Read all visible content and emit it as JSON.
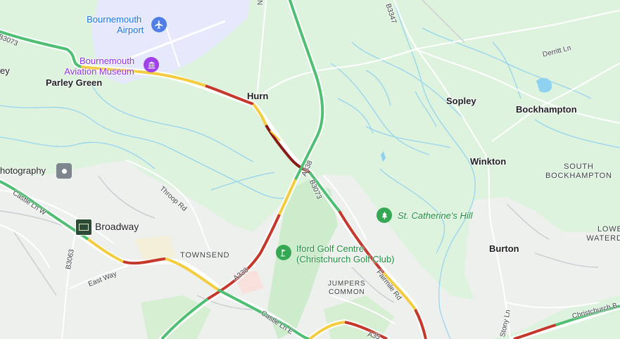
{
  "map": {
    "colors": {
      "rural": "#def3de",
      "urban": "#eef0ee",
      "airport": "#e6e9fb",
      "water": "#8fd1f0",
      "traffic_free": "#4fbf73",
      "traffic_slow": "#f3cd3f",
      "traffic_heavy": "#c5392c",
      "traffic_severe": "#8a1a15"
    },
    "places": {
      "bournemouth_airport": [
        "Bournemouth",
        "Airport"
      ],
      "aviation_museum": [
        "Bournemouth",
        "Aviation Museum"
      ],
      "parley_green": "Parley Green",
      "hurn": "Hurn",
      "sopley": "Sopley",
      "bockhampton": "Bockhampton",
      "winkton": "Winkton",
      "south_bockhampton": [
        "SOUTH",
        "BOCKHAMPTON"
      ],
      "burton": "Burton",
      "lower_waterditch": [
        "LOWE",
        "WATERD"
      ],
      "broadway": "Broadway",
      "townsend": "TOWNSEND",
      "jumpers_common": [
        "JUMPERS",
        "COMMON"
      ],
      "st_catherines_hill": "St. Catherine's Hill",
      "iford_golf": [
        "Iford Golf Centre",
        "(Christchurch Golf Club)"
      ],
      "photography": "hotography",
      "ey": "ey"
    },
    "roads": {
      "b3073_west": "B3073",
      "b3347": "B3347",
      "derritt_ln": "Derritt Ln",
      "throop_rd": "Throop Rd",
      "castle_ln_w": "Castle Ln W",
      "b3063": "B3063",
      "east_way": "East Way",
      "a338_north": "A338",
      "a338_south": "A338",
      "b3073_east": "B3073",
      "fairmile_rd": "Fairmile Rd",
      "castle_ln_e": "Castle Ln E",
      "a35": "A35",
      "stony_ln": "Stony Ln",
      "christchurch_bypass": "Christchurch B",
      "n_top": "N"
    },
    "icons": {
      "airport": "airport-icon",
      "museum": "museum-icon",
      "park": "tree-icon",
      "golf": "golf-icon",
      "photo": "camera-icon",
      "shop": "store-icon"
    }
  }
}
